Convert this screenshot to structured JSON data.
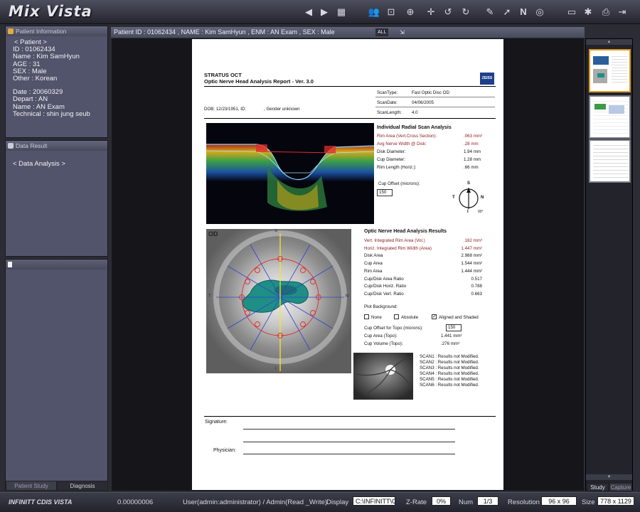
{
  "app": {
    "title": "Mix Vista",
    "footer_title": "INFINITT CDIS VISTA"
  },
  "toolbar": {
    "icons": [
      "arrow-left-icon",
      "arrow-right-icon",
      "grid-layout-icon",
      "users-icon",
      "fit-screen-icon",
      "zoom-icon",
      "pan-icon",
      "rotate-left-icon",
      "rotate-right-icon",
      "edit-icon",
      "pointer-icon",
      "text-annotation-icon",
      "globe-icon",
      "window-layout-icon",
      "settings-icon",
      "print-icon",
      "exit-icon"
    ]
  },
  "patient_panel": {
    "header": "Patient Information",
    "nav": "<   Patient   >",
    "id": "ID : 01062434",
    "name": "Name : Kim SamHyun",
    "age": "AGE : 31",
    "sex": "SEX : Male",
    "other": "Other : Korean",
    "date": "Date : 20060329",
    "depart": "Depart : AN",
    "exam": "Name : AN Exam",
    "technical": "Technical : shin jung seub"
  },
  "data_panel": {
    "header": "Data Result",
    "item": "<   Data Analysis   >"
  },
  "bottom_tabs": [
    "Patient Study",
    "Diagnosis"
  ],
  "header_strip": {
    "text": "Patient ID : 01062434 , NAME : Kim SamHyun , ENM : AN Exam , SEX : Male",
    "all_label": "ALL"
  },
  "report": {
    "title": "STRATUS OCT",
    "subtitle": "Optic Nerve Head Analysis Report - Ver. 3.0",
    "brand": "ZEISS",
    "scan_type_label": "ScanType:",
    "scan_type_value": "Fast Optic Disc  OD",
    "scan_date_label": "ScanDate:",
    "scan_date_value": "04/06/2005",
    "scan_length_label": "ScanLength:",
    "scan_length_value": "4.0",
    "dob": "DOB: 12/23/1951, ID:",
    "gender": ", Gender unknown",
    "radial_title": "Individual Radial Scan Analysis",
    "radial_rows": [
      {
        "label": "Rim Area (Vert.Cross Section):",
        "value": ".063 mm²",
        "red": true
      },
      {
        "label": "Avg Nerve Width @ Disk:",
        "value": ".28 mm",
        "red": true
      },
      {
        "label": "Disk Diameter:",
        "value": "1.94 mm",
        "red": false
      },
      {
        "label": "Cup Diameter:",
        "value": "1.28 mm",
        "red": false
      },
      {
        "label": "Rim Length (Horiz.):",
        "value": ".66 mm",
        "red": false
      }
    ],
    "cup_offset_label": "Cup Offset (microns):",
    "cup_offset_value": "150",
    "compass": {
      "s": "S",
      "t": "T",
      "n": "N",
      "i": "I",
      "deg": "90°"
    },
    "od_label": "OD",
    "map_labels": {
      "s": "S",
      "t": "T",
      "n": "N",
      "i": "I"
    },
    "onh_title": "Optic Nerve Head Analysis Results",
    "onh_rows": [
      {
        "label": "Vert. Integrated Rim Area (Vol.)",
        "value": ".182 mm³",
        "red": true
      },
      {
        "label": "Horiz. Integrated Rim Width (Area)",
        "value": "1.447 mm²",
        "red": true
      },
      {
        "label": "Disk Area",
        "value": "2.988 mm²",
        "red": false
      },
      {
        "label": "Cup Area",
        "value": "1.544 mm²",
        "red": false
      },
      {
        "label": "Rim Area",
        "value": "1.444 mm²",
        "red": false
      },
      {
        "label": "Cup/Disk Area Ratio",
        "value": "0.517",
        "red": false
      },
      {
        "label": "Cup/Disk Horiz. Ratio",
        "value": "0.788",
        "red": false
      },
      {
        "label": "Cup/Disk Vert. Ratio",
        "value": "0.663",
        "red": false
      }
    ],
    "plot_bg_label": "Plot Background:",
    "plot_bg_options": [
      {
        "label": "None",
        "checked": false
      },
      {
        "label": "Absolute",
        "checked": false
      },
      {
        "label": "Aligned and Shaded",
        "checked": true
      }
    ],
    "cup_offset_topo_label": "Cup Offset for Topo (microns):",
    "cup_offset_topo_value": "150",
    "cup_area_topo": "Cup Area (Topo):",
    "cup_area_topo_value": "1.441 mm²",
    "cup_volume_topo": "Cup Volume (Topo):",
    "cup_volume_topo_value": ".276 mm³",
    "scans": [
      "SCAN1 : Results not Modified.",
      "SCAN2 : Results not Modified.",
      "SCAN3 : Results not Modified.",
      "SCAN4 : Results not Modified.",
      "SCAN5 : Results not Modified.",
      "SCAN6 : Results not Modified."
    ],
    "signature_label": "Signature:",
    "physician_label": "Physician:"
  },
  "right_tabs": [
    "Study",
    "Capture"
  ],
  "status": {
    "value": "0.00000006",
    "user": "User(admin:administrator) / Admin(Read _Write)",
    "display_label": "Display",
    "display_value": "C:\\INFINITT\\CDIS",
    "zrate_label": "Z-Rate",
    "zrate_value": "0%",
    "num_label": "Num",
    "num_value": "1/3",
    "resolution_label": "Resolution",
    "resolution_value": "96 x 96",
    "size_label": "Size",
    "size_value": "778 x 1129"
  },
  "colors": {
    "accent": "#e0981f",
    "panel": "#51546a",
    "header": "#464959",
    "report_red": "#8b1b1b",
    "cup_teal": "#1f8f86"
  }
}
